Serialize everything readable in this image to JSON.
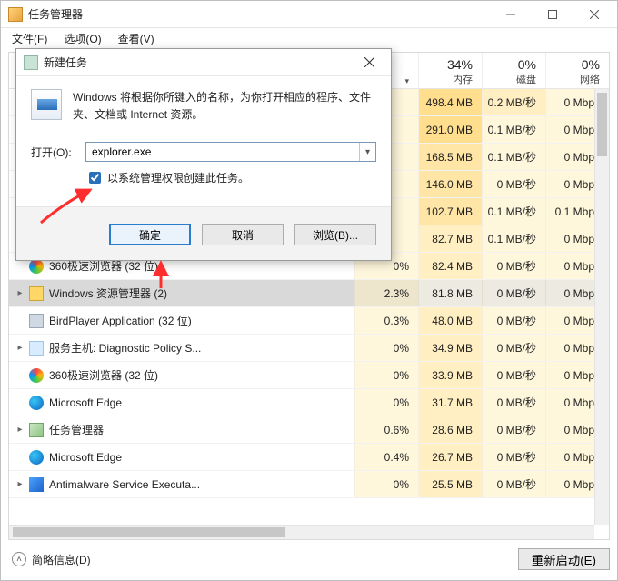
{
  "window": {
    "title": "任务管理器"
  },
  "menubar": {
    "file": "文件(F)",
    "options": "选项(O)",
    "view": "查看(V)"
  },
  "columns": {
    "cpu": {
      "value": "",
      "label": ""
    },
    "memory": {
      "value": "34%",
      "label": "内存"
    },
    "disk": {
      "value": "0%",
      "label": "磁盘"
    },
    "network": {
      "value": "0%",
      "label": "网络"
    }
  },
  "rows": [
    {
      "name": "",
      "expand": false,
      "icon": "none",
      "mem": "498.4 MB",
      "disk": "0.2 MB/秒",
      "net": "0 Mbps",
      "memTint": 4,
      "diskTint": 2,
      "netTint": 1
    },
    {
      "name": "",
      "expand": false,
      "icon": "none",
      "mem": "291.0 MB",
      "disk": "0.1 MB/秒",
      "net": "0 Mbps",
      "memTint": 4,
      "diskTint": 1,
      "netTint": 1
    },
    {
      "name": "",
      "expand": false,
      "icon": "none",
      "mem": "168.5 MB",
      "disk": "0.1 MB/秒",
      "net": "0 Mbps",
      "memTint": 3,
      "diskTint": 1,
      "netTint": 1
    },
    {
      "name": "",
      "expand": false,
      "icon": "none",
      "mem": "146.0 MB",
      "disk": "0 MB/秒",
      "net": "0 Mbps",
      "memTint": 3,
      "diskTint": 1,
      "netTint": 1
    },
    {
      "name": "",
      "expand": false,
      "icon": "none",
      "mem": "102.7 MB",
      "disk": "0.1 MB/秒",
      "net": "0.1 Mbps",
      "memTint": 3,
      "diskTint": 1,
      "netTint": 1
    },
    {
      "name": "",
      "expand": false,
      "icon": "none",
      "mem": "82.7 MB",
      "disk": "0.1 MB/秒",
      "net": "0 Mbps",
      "memTint": 2,
      "diskTint": 1,
      "netTint": 1
    },
    {
      "name": "360极速浏览器 (32 位)",
      "expand": false,
      "icon": "360",
      "cpu": "0%",
      "mem": "82.4 MB",
      "disk": "0 MB/秒",
      "net": "0 Mbps",
      "memTint": 2,
      "diskTint": 1,
      "netTint": 1
    },
    {
      "name": "Windows 资源管理器 (2)",
      "expand": true,
      "icon": "folder",
      "cpu": "2.3%",
      "mem": "81.8 MB",
      "disk": "0 MB/秒",
      "net": "0 Mbps",
      "memTint": 0,
      "diskTint": 0,
      "netTint": 0,
      "selected": true
    },
    {
      "name": "BirdPlayer Application (32 位)",
      "expand": false,
      "icon": "generic",
      "cpu": "0.3%",
      "mem": "48.0 MB",
      "disk": "0 MB/秒",
      "net": "0 Mbps",
      "memTint": 2,
      "diskTint": 1,
      "netTint": 1
    },
    {
      "name": "服务主机: Diagnostic Policy S...",
      "expand": true,
      "icon": "gear",
      "cpu": "0%",
      "mem": "34.9 MB",
      "disk": "0 MB/秒",
      "net": "0 Mbps",
      "memTint": 2,
      "diskTint": 1,
      "netTint": 1
    },
    {
      "name": "360极速浏览器 (32 位)",
      "expand": false,
      "icon": "360",
      "cpu": "0%",
      "mem": "33.9 MB",
      "disk": "0 MB/秒",
      "net": "0 Mbps",
      "memTint": 2,
      "diskTint": 1,
      "netTint": 1
    },
    {
      "name": "Microsoft Edge",
      "expand": false,
      "icon": "edge",
      "cpu": "0%",
      "mem": "31.7 MB",
      "disk": "0 MB/秒",
      "net": "0 Mbps",
      "memTint": 2,
      "diskTint": 1,
      "netTint": 1
    },
    {
      "name": "任务管理器",
      "expand": true,
      "icon": "tm",
      "cpu": "0.6%",
      "mem": "28.6 MB",
      "disk": "0 MB/秒",
      "net": "0 Mbps",
      "memTint": 2,
      "diskTint": 1,
      "netTint": 1
    },
    {
      "name": "Microsoft Edge",
      "expand": false,
      "icon": "edge",
      "cpu": "0.4%",
      "mem": "26.7 MB",
      "disk": "0 MB/秒",
      "net": "0 Mbps",
      "memTint": 2,
      "diskTint": 1,
      "netTint": 1
    },
    {
      "name": "Antimalware Service Executa...",
      "expand": true,
      "icon": "shield",
      "cpu": "0%",
      "mem": "25.5 MB",
      "disk": "0 MB/秒",
      "net": "0 Mbps",
      "memTint": 2,
      "diskTint": 1,
      "netTint": 1
    }
  ],
  "statusbar": {
    "fewer": "简略信息(D)",
    "restart": "重新启动(E)"
  },
  "dialog": {
    "title": "新建任务",
    "description": "Windows 将根据你所键入的名称，为你打开相应的程序、文件夹、文档或 Internet 资源。",
    "open_label": "打开(O):",
    "open_value": "explorer.exe",
    "admin_label": "以系统管理权限创建此任务。",
    "admin_checked": true,
    "ok": "确定",
    "cancel": "取消",
    "browse": "浏览(B)..."
  }
}
